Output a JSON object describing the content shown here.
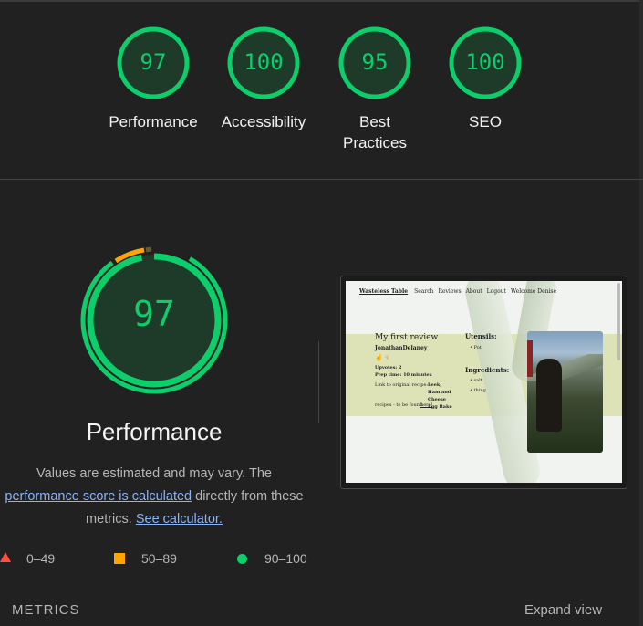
{
  "summary": [
    {
      "score": "97",
      "label": "Performance"
    },
    {
      "score": "100",
      "label": "Accessibility"
    },
    {
      "score": "95",
      "label": "Best Practices"
    },
    {
      "score": "100",
      "label": "SEO"
    }
  ],
  "performance": {
    "score": "97",
    "title": "Performance",
    "desc_line1": "Values are estimated and may vary. The",
    "desc_link1": "performance score is calculated",
    "desc_line2": "directly from these",
    "desc_line3": "metrics.",
    "desc_link2": "See calculator."
  },
  "legend": {
    "fail": "0–49",
    "average": "50–89",
    "pass": "90–100"
  },
  "colors": {
    "pass": "#0cce6b",
    "average": "#ffa400",
    "fail": "#ff4e42",
    "background": "#212121"
  },
  "thumbnail": {
    "nav_brand": "Wasteless Table",
    "nav_items": [
      "Search",
      "Reviews",
      "About",
      "Logout",
      "Welcome Denise"
    ],
    "title": "My first review",
    "author": "JonathanDelaney",
    "upvotes": "Upvotes: 2",
    "prep": "Prep time: 10 minutes",
    "link_text": "Link to original recipe:",
    "recipe": "Leek, Ham and Cheese Egg Bake",
    "recipe_suffix": "recipes - to be found",
    "here": "here!",
    "utensils_heading": "Utensils:",
    "utensils": [
      "Pot"
    ],
    "ingredients_heading": "Ingredients:",
    "ingredients": [
      "salt",
      "thing"
    ]
  },
  "footer": {
    "metrics_label": "METRICS",
    "expand_label": "Expand view"
  }
}
